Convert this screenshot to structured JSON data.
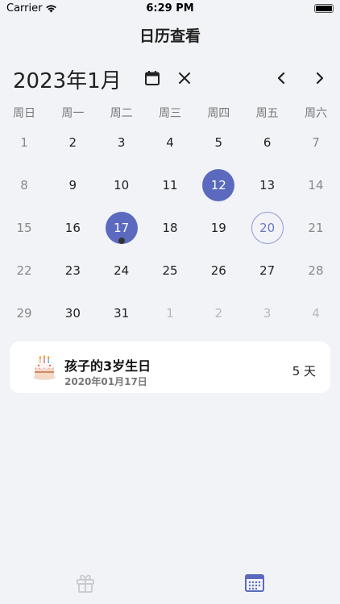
{
  "status_bar": {
    "carrier": "Carrier",
    "time": "6:29 PM"
  },
  "nav": {
    "title": "日历查看"
  },
  "calendar": {
    "month_label": "2023年1月",
    "weekdays": [
      "周日",
      "周一",
      "周二",
      "周三",
      "周四",
      "周五",
      "周六"
    ],
    "weeks": [
      [
        {
          "n": "1"
        },
        {
          "n": "2"
        },
        {
          "n": "3"
        },
        {
          "n": "4"
        },
        {
          "n": "5"
        },
        {
          "n": "6"
        },
        {
          "n": "7"
        }
      ],
      [
        {
          "n": "8"
        },
        {
          "n": "9"
        },
        {
          "n": "10"
        },
        {
          "n": "11"
        },
        {
          "n": "12",
          "selected": true
        },
        {
          "n": "13"
        },
        {
          "n": "14"
        }
      ],
      [
        {
          "n": "15"
        },
        {
          "n": "16"
        },
        {
          "n": "17",
          "selected": true,
          "event": true
        },
        {
          "n": "18"
        },
        {
          "n": "19"
        },
        {
          "n": "20",
          "today": true
        },
        {
          "n": "21"
        }
      ],
      [
        {
          "n": "22"
        },
        {
          "n": "23"
        },
        {
          "n": "24"
        },
        {
          "n": "25"
        },
        {
          "n": "26"
        },
        {
          "n": "27"
        },
        {
          "n": "28"
        }
      ],
      [
        {
          "n": "29"
        },
        {
          "n": "30"
        },
        {
          "n": "31"
        },
        {
          "n": "1",
          "other": true
        },
        {
          "n": "2",
          "other": true
        },
        {
          "n": "3",
          "other": true
        },
        {
          "n": "4",
          "other": true
        }
      ]
    ],
    "accent_color": "#5b6abf"
  },
  "event": {
    "icon": "birthday-cake-icon",
    "title": "孩子的3岁生日",
    "date": "2020年01月17日",
    "count": "5 天"
  },
  "tabbar": {
    "items": [
      {
        "icon": "gift-icon",
        "active": false
      },
      {
        "icon": "calendar-icon",
        "active": true
      }
    ],
    "active_color": "#5b6abf",
    "inactive_color": "#c8c9cf"
  }
}
